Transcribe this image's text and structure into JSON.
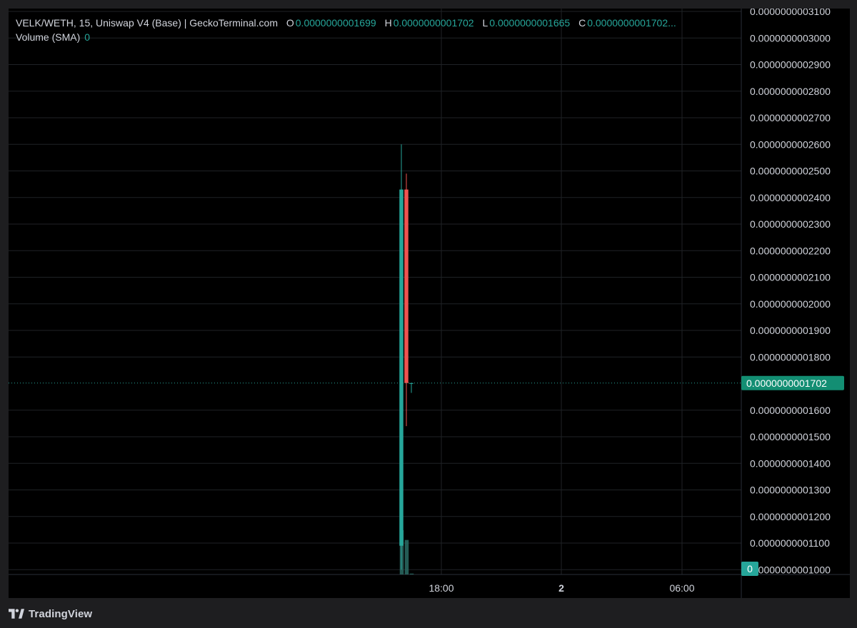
{
  "legend": {
    "title": "VELK/WETH, 15, Uniswap V4 (Base) | GeckoTerminal.com",
    "o_key": "O",
    "o_val": "0.0000000001699",
    "h_key": "H",
    "h_val": "0.0000000001702",
    "l_key": "L",
    "l_val": "0.0000000001665",
    "c_key": "C",
    "c_val": "0.0000000001702...",
    "volume_label": "Volume (SMA)",
    "volume_value": "0"
  },
  "colors": {
    "up": "#26a69a",
    "down": "#ef5350",
    "grid": "#1f2226",
    "axis_text": "#d1d4dc",
    "background": "#000000",
    "price_badge": "#138e73"
  },
  "footer": {
    "brand": "TradingView",
    "icon": "tradingview-logo-icon"
  },
  "chart_data": {
    "type": "candlestick",
    "timeframe": "15",
    "y_ticks": [
      "0.0000000003100",
      "0.0000000003000",
      "0.0000000002900",
      "0.0000000002800",
      "0.0000000002700",
      "0.0000000002600",
      "0.0000000002500",
      "0.0000000002400",
      "0.0000000002300",
      "0.0000000002200",
      "0.0000000002100",
      "0.0000000002000",
      "0.0000000001900",
      "0.0000000001800",
      "0.0000000001600",
      "0.0000000001500",
      "0.0000000001400",
      "0.0000000001300",
      "0.0000000001200",
      "0.0000000001100",
      "0.0000000001000"
    ],
    "x_ticks": [
      "18:00",
      "2",
      "06:00"
    ],
    "ylim": [
      1e-10,
      3.1e-10
    ],
    "current_price_label": "0.0000000001702",
    "current_price": 1.702e-10,
    "volume_label_value": "0",
    "candles": [
      {
        "o": 1.09e-10,
        "h": 2.6e-10,
        "l": 1e-10,
        "c": 2.43e-10,
        "dir": "up"
      },
      {
        "o": 2.43e-10,
        "h": 2.49e-10,
        "l": 1.54e-10,
        "c": 1.702e-10,
        "dir": "down"
      },
      {
        "o": 1.699e-10,
        "h": 1.702e-10,
        "l": 1.665e-10,
        "c": 1.702e-10,
        "dir": "up"
      }
    ],
    "volumes": [
      1.0,
      0.78,
      0.02
    ]
  }
}
